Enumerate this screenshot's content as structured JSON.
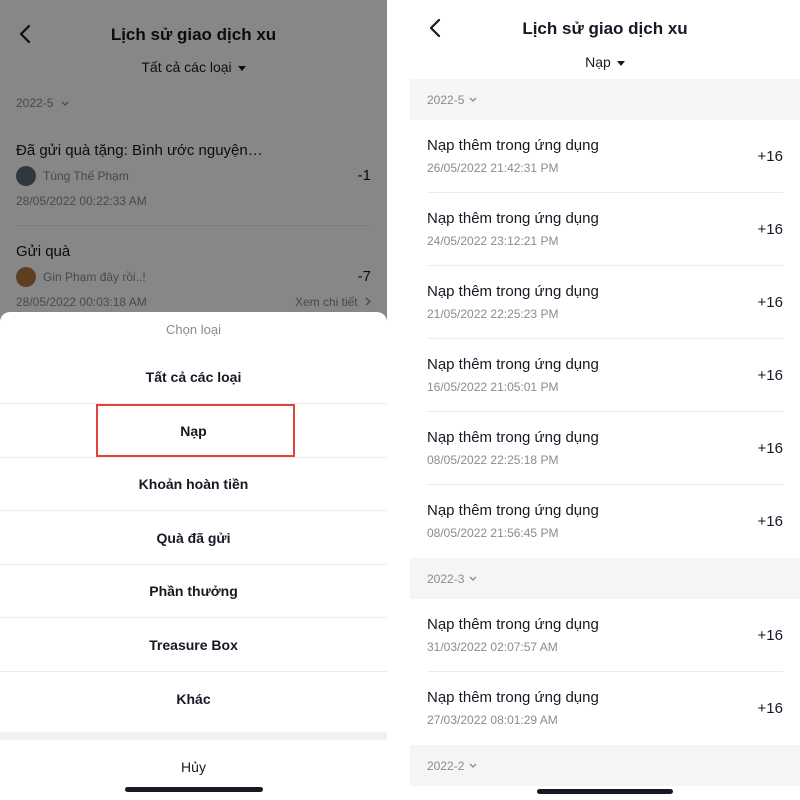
{
  "left": {
    "header": {
      "title": "Lịch sử giao dịch xu",
      "filter": "Tất cả các loại"
    },
    "month": "2022-5",
    "transactions": [
      {
        "title": "Đã gửi quà tặng: Bình ước nguyện…",
        "user": "Tùng Thế Phạm",
        "amount": "-1",
        "date": "28/05/2022 00:22:33 AM"
      },
      {
        "title": "Gửi quà",
        "user": "Gin Phạm đây rồi..!",
        "amount": "-7",
        "date": "28/05/2022 00:03:18 AM",
        "detail": "Xem chi tiết"
      }
    ],
    "sheet": {
      "heading": "Chọn loại",
      "options": [
        "Tất cả các loại",
        "Nạp",
        "Khoản hoàn tiền",
        "Quà đã gửi",
        "Phần thưởng",
        "Treasure Box",
        "Khác"
      ],
      "selected_index": 1,
      "cancel": "Hủy"
    }
  },
  "right": {
    "header": {
      "title": "Lịch sử giao dịch xu",
      "filter": "Nạp"
    },
    "groups": [
      {
        "month": "2022-5",
        "rows": [
          {
            "title": "Nạp thêm trong ứng dụng",
            "date": "26/05/2022 21:42:31 PM",
            "amount": "+16"
          },
          {
            "title": "Nạp thêm trong ứng dụng",
            "date": "24/05/2022 23:12:21 PM",
            "amount": "+16"
          },
          {
            "title": "Nạp thêm trong ứng dụng",
            "date": "21/05/2022 22:25:23 PM",
            "amount": "+16"
          },
          {
            "title": "Nạp thêm trong ứng dụng",
            "date": "16/05/2022 21:05:01 PM",
            "amount": "+16"
          },
          {
            "title": "Nạp thêm trong ứng dụng",
            "date": "08/05/2022 22:25:18 PM",
            "amount": "+16"
          },
          {
            "title": "Nạp thêm trong ứng dụng",
            "date": "08/05/2022 21:56:45 PM",
            "amount": "+16"
          }
        ]
      },
      {
        "month": "2022-3",
        "rows": [
          {
            "title": "Nạp thêm trong ứng dụng",
            "date": "31/03/2022 02:07:57 AM",
            "amount": "+16"
          },
          {
            "title": "Nạp thêm trong ứng dụng",
            "date": "27/03/2022 08:01:29 AM",
            "amount": "+16"
          }
        ]
      },
      {
        "month": "2022-2",
        "rows": []
      }
    ]
  },
  "icons": {
    "back": "chevron-left-icon",
    "caret": "caret-down-icon",
    "month_chevron": "chevron-down-icon",
    "detail_chevron": "chevron-right-icon"
  },
  "colors": {
    "highlight": "#e0443d",
    "text": "#161823",
    "secondary": "#8a8b91",
    "overlay": "rgba(0,0,0,0.47)"
  }
}
